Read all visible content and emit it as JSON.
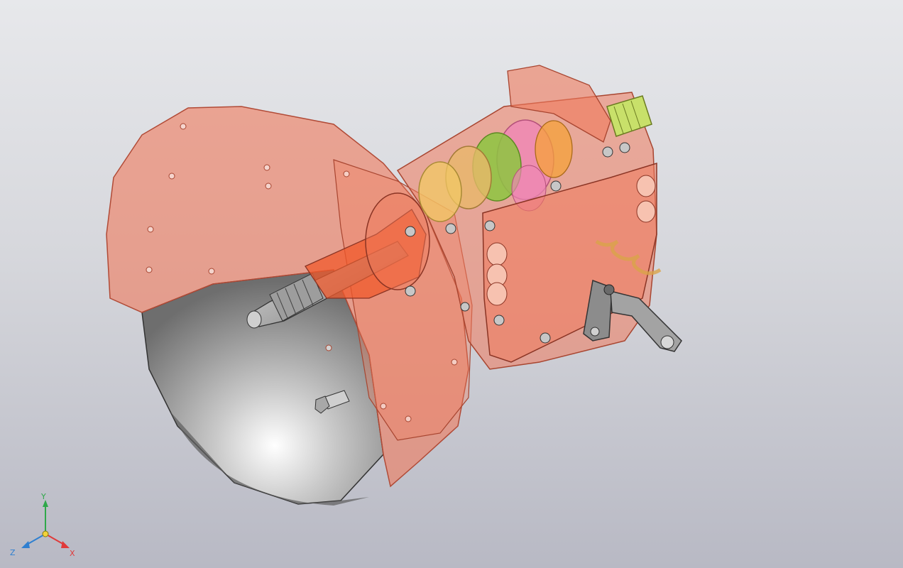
{
  "viewport": {
    "background_top": "#e7e8eb",
    "background_bottom": "#b8b9c4"
  },
  "model": {
    "housing_color": "#f07a5c",
    "steel_color": "#9a9a9a",
    "gear_colors": [
      "#ee88b4",
      "#8cc63f",
      "#f1c864",
      "#e8b86a"
    ],
    "shaft_color": "#c8e06a"
  },
  "triad": {
    "y_label": "Y",
    "z_label": "Z",
    "x_label": "X",
    "x_color": "#e03a3a",
    "y_color": "#2fa84a",
    "z_color": "#2f7fd0"
  }
}
